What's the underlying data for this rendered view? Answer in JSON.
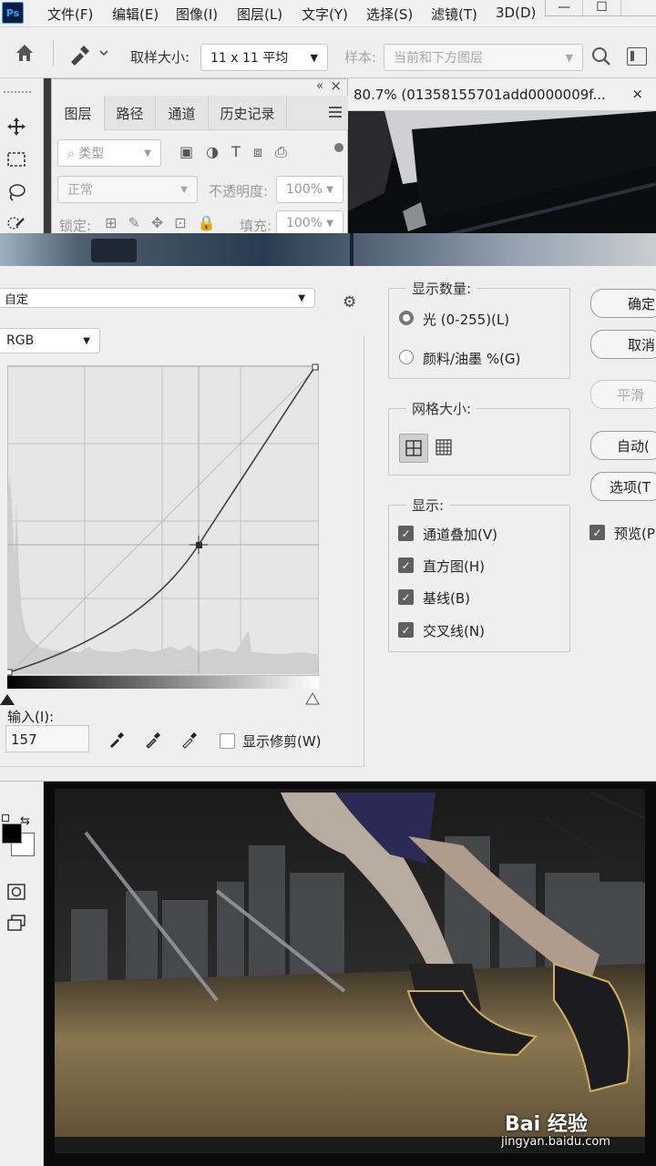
{
  "app": {
    "logo": "Ps"
  },
  "menu": [
    "文件(F)",
    "编辑(E)",
    "图像(I)",
    "图层(L)",
    "文字(Y)",
    "选择(S)",
    "滤镜(T)",
    "3D(D)"
  ],
  "window_controls": {
    "minimize": "—",
    "maximize": "☐"
  },
  "options_bar": {
    "sample_size_label": "取样大小:",
    "sample_size_value": "11 x 11 平均",
    "sample_label": "样本:",
    "sample_value": "当前和下方图层"
  },
  "layers_panel": {
    "collapse": "«",
    "close": "×",
    "tabs": [
      "图层",
      "路径",
      "通道",
      "历史记录"
    ],
    "filter_kind": "类型",
    "blend_mode": "正常",
    "opacity_label": "不透明度:",
    "opacity_value": "100%",
    "lock_label": "锁定:",
    "fill_label": "填充:",
    "fill_value": "100%"
  },
  "document_tab": {
    "title": "80.7% (01358155701add0000009f...",
    "close": "×"
  },
  "curves": {
    "preset_value": "自定",
    "channel": "RGB",
    "input_label": "输入(I):",
    "input_value": "157",
    "show_clipping": "显示修剪(W)",
    "show_amount": {
      "title": "显示数量:",
      "light": "光 (0-255)(L)",
      "pigment": "颜料/油墨 %(G)",
      "selected": "light"
    },
    "grid_size": {
      "title": "网格大小:"
    },
    "display": {
      "title": "显示:",
      "options": [
        {
          "label": "通道叠加(V)",
          "checked": true
        },
        {
          "label": "直方图(H)",
          "checked": true
        },
        {
          "label": "基线(B)",
          "checked": true
        },
        {
          "label": "交叉线(N)",
          "checked": true
        }
      ]
    },
    "buttons": {
      "ok": "确定",
      "cancel": "取消",
      "smooth": "平滑",
      "auto": "自动(",
      "options": "选项(T"
    },
    "preview": {
      "label": "预览(P",
      "checked": true
    }
  },
  "watermark": {
    "brand": "Bai 经验",
    "url": "jingyan.baidu.com"
  }
}
